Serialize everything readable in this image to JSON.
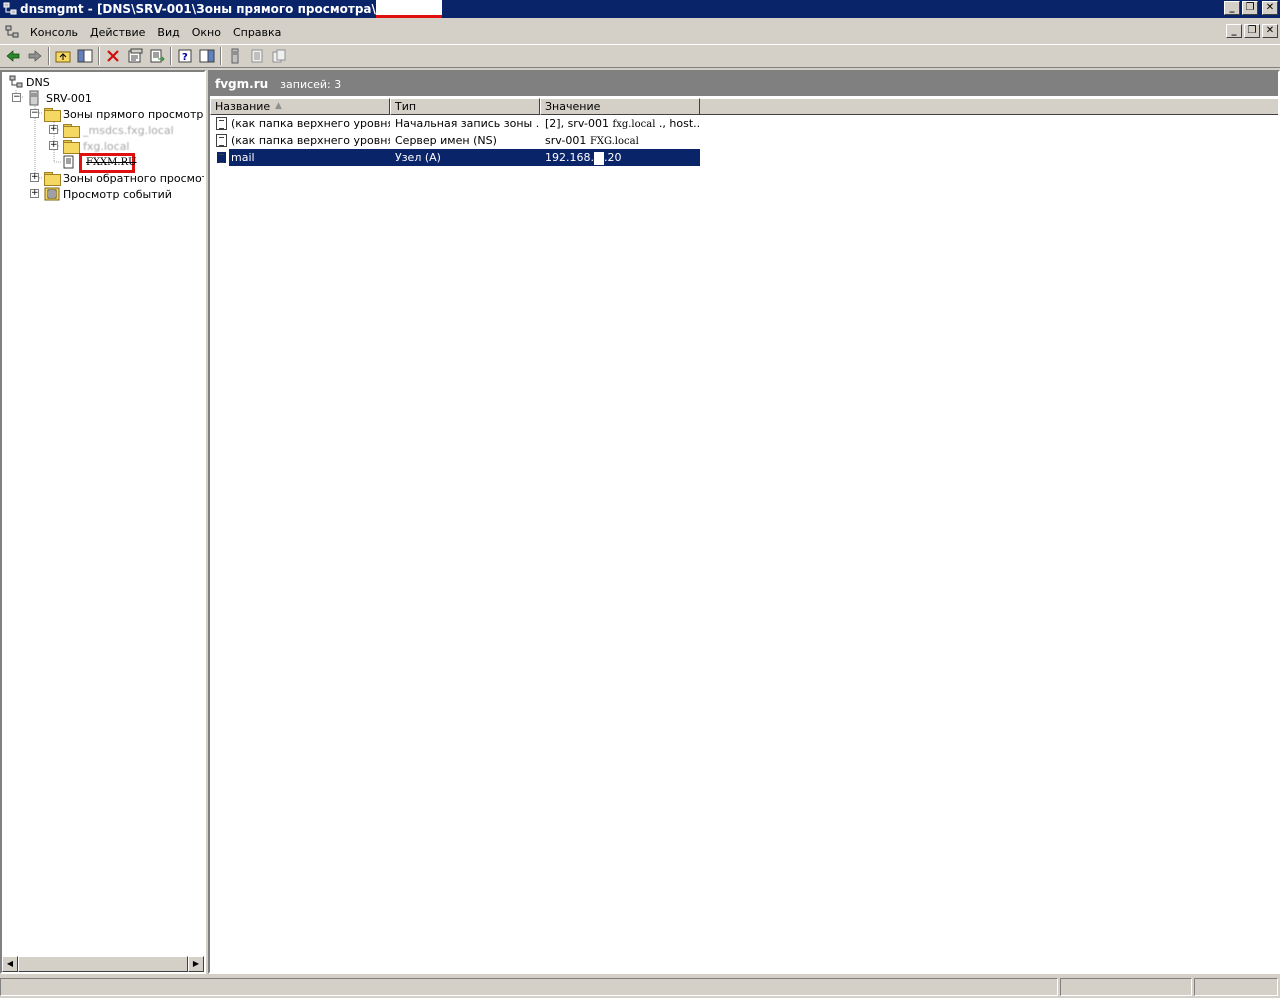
{
  "window": {
    "title": "dnsmgmt - [DNS\\SRV-001\\Зоны прямого просмотра\\",
    "buttons": {
      "minimize": "_",
      "restore": "❐",
      "close": "✕"
    }
  },
  "menu": {
    "items": [
      {
        "label": "Консоль"
      },
      {
        "label": "Действие"
      },
      {
        "label": "Вид"
      },
      {
        "label": "Окно"
      },
      {
        "label": "Справка"
      }
    ]
  },
  "tree": {
    "root": "DNS",
    "server": "SRV-001",
    "forward_zones": "Зоны прямого просмотра",
    "zone_1": "_msdcs.fxg.local",
    "zone_2": "fxg.local",
    "zone_3": "FXXM.RU",
    "reverse_zones": "Зоны обратного просмотра",
    "events": "Просмотр событий"
  },
  "results": {
    "zone_name": "fvgm.ru",
    "record_count": "записей: 3",
    "columns": [
      "Название",
      "Тип",
      "Значение"
    ],
    "rows": [
      {
        "name": "(как папка верхнего уровня)",
        "type": "Начальная запись зоны ...",
        "value_a": "[2], srv-001",
        "value_b": "fxg.local",
        "value_c": "., host..."
      },
      {
        "name": "(как папка верхнего уровня)",
        "type": "Сервер имен (NS)",
        "value_a": "srv-001",
        "value_b": "FXG.local",
        "value_c": ""
      },
      {
        "name": "mail",
        "type": "Узел (A)",
        "value_a": "192.168.",
        "value_b": "",
        "value_c": ".20"
      }
    ]
  },
  "colors": {
    "titlebar": "#0a246a",
    "selection": "#0a246a",
    "chrome": "#d4d0c8",
    "redaction": "#e01010"
  },
  "icons": {
    "back": "arrow-left-icon",
    "forward": "arrow-right-icon",
    "up": "folder-up-icon",
    "show_tree": "console-tree-icon",
    "delete": "delete-icon",
    "properties": "properties-icon",
    "export": "export-list-icon",
    "help": "help-icon",
    "mmc": "mmc-icon"
  }
}
